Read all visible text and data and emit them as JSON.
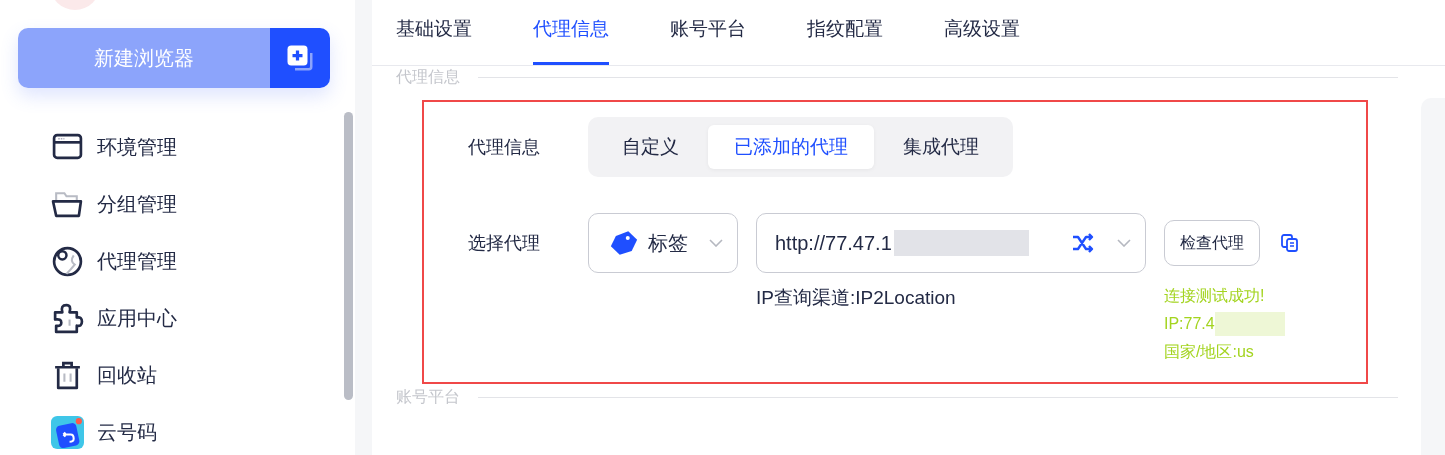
{
  "sidebar": {
    "create_button": {
      "label": "新建浏览器"
    },
    "items": [
      {
        "label": "环境管理"
      },
      {
        "label": "分组管理"
      },
      {
        "label": "代理管理"
      },
      {
        "label": "应用中心"
      },
      {
        "label": "回收站"
      },
      {
        "label": "云号码"
      }
    ]
  },
  "tabs": [
    {
      "label": "基础设置",
      "selected": false
    },
    {
      "label": "代理信息",
      "selected": true
    },
    {
      "label": "账号平台",
      "selected": false
    },
    {
      "label": "指纹配置",
      "selected": false
    },
    {
      "label": "高级设置",
      "selected": false
    }
  ],
  "sections": [
    {
      "title": "代理信息"
    },
    {
      "title": "账号平台"
    }
  ],
  "proxy": {
    "label": "代理信息",
    "modes": [
      {
        "label": "自定义",
        "selected": false
      },
      {
        "label": "已添加的代理",
        "selected": true
      },
      {
        "label": "集成代理",
        "selected": false
      }
    ],
    "select_label": "选择代理",
    "tag_select": {
      "value": "标签"
    },
    "proxy_select": {
      "value": "http://77.47.1"
    },
    "check_button": "检查代理",
    "ip_channel": "IP查询渠道:IP2Location",
    "result": [
      "连接测试成功!",
      "IP:77.4",
      "国家/地区:us"
    ]
  }
}
